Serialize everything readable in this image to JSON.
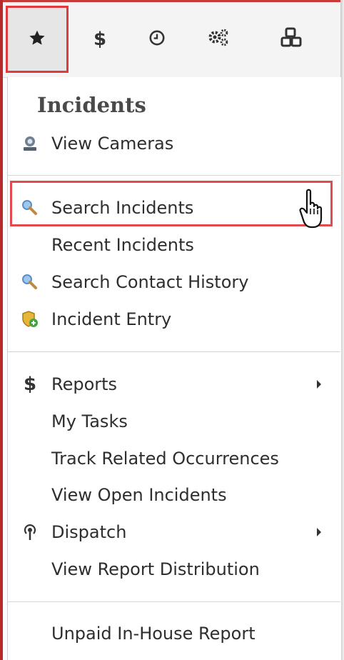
{
  "toolbar": {
    "tabs": [
      {
        "name": "favorites",
        "icon": "star-icon"
      },
      {
        "name": "finance",
        "icon": "dollar-icon"
      },
      {
        "name": "history",
        "icon": "clock-icon"
      },
      {
        "name": "settings",
        "icon": "gears-icon"
      },
      {
        "name": "modules",
        "icon": "cubes-icon"
      }
    ],
    "dollar_glyph": "$"
  },
  "menu": {
    "section_title": "Incidents",
    "items": [
      {
        "label": "View Cameras",
        "icon": "camera-icon"
      },
      {
        "label": "Search Incidents",
        "icon": "magnifier-icon",
        "highlighted": true
      },
      {
        "label": "Recent Incidents",
        "icon": ""
      },
      {
        "label": "Search Contact History",
        "icon": "magnifier-icon"
      },
      {
        "label": "Incident Entry",
        "icon": "shield-add-icon"
      },
      {
        "label": "Reports",
        "icon": "dollar-icon",
        "submenu": true
      },
      {
        "label": "My Tasks",
        "icon": ""
      },
      {
        "label": "Track Related Occurrences",
        "icon": ""
      },
      {
        "label": "View Open Incidents",
        "icon": ""
      },
      {
        "label": "Dispatch",
        "icon": "broadcast-icon",
        "submenu": true
      },
      {
        "label": "View Report Distribution",
        "icon": ""
      },
      {
        "label": "Unpaid In-House Report",
        "icon": ""
      }
    ]
  },
  "colors": {
    "highlight_border": "#e24a4e",
    "accent_edge": "#b52a2a"
  }
}
